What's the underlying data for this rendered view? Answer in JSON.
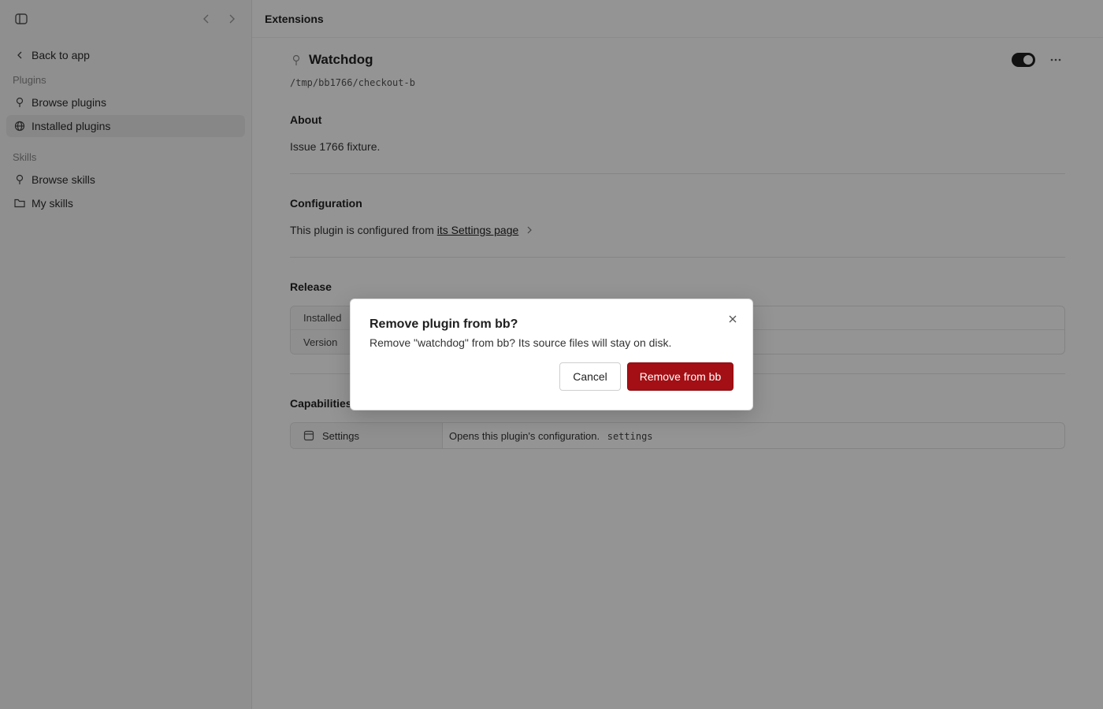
{
  "sidebar": {
    "back_label": "Back to app",
    "section_plugins": "Plugins",
    "browse_plugins": "Browse plugins",
    "installed_plugins": "Installed plugins",
    "section_skills": "Skills",
    "browse_skills": "Browse skills",
    "my_skills": "My skills"
  },
  "header": {
    "title": "Extensions"
  },
  "plugin": {
    "name": "Watchdog",
    "path": "/tmp/bb1766/checkout-b",
    "enabled": true,
    "about_title": "About",
    "about_text": "Issue 1766 fixture.",
    "config_title": "Configuration",
    "config_text": "This plugin is configured from",
    "config_link": "its Settings page",
    "release_title": "Release",
    "release_rows": [
      {
        "label": "Installed",
        "value": ""
      },
      {
        "label": "Version",
        "value": ""
      }
    ],
    "capabilities_title": "Capabilities",
    "capability": {
      "name": "Settings",
      "description": "Opens this plugin's configuration.",
      "code": "settings"
    }
  },
  "dialog": {
    "title": "Remove plugin from bb?",
    "description": "Remove \"watchdog\" from bb? Its source files will stay on disk.",
    "cancel_label": "Cancel",
    "confirm_label": "Remove from bb",
    "confirm_color": "#a30f14"
  },
  "icons": {
    "sidebar_toggle": "sidebar-toggle-icon",
    "back": "chevron-left-icon",
    "forward": "chevron-right-icon",
    "plugin": "pin-icon",
    "installed": "globe-icon",
    "folder": "folder-icon",
    "more": "ellipsis-icon",
    "close": "close-icon",
    "settings": "window-icon"
  }
}
